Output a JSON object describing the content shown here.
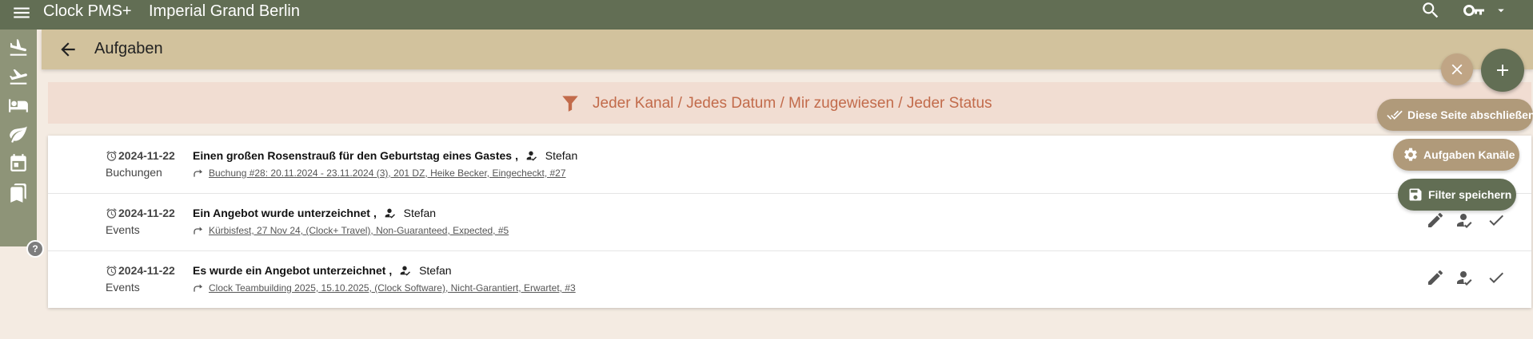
{
  "topbar": {
    "app_title": "Clock PMS+",
    "hotel_name": "Imperial Grand Berlin",
    "icons": [
      "menu-icon",
      "search-icon",
      "key-icon",
      "caret-down-icon"
    ]
  },
  "sidebar": {
    "items": [
      "arrivals-icon",
      "departures-icon",
      "bed-icon",
      "leaf-icon",
      "calendar-icon",
      "bookmark-icon"
    ],
    "help_label": "?"
  },
  "header": {
    "title": "Aufgaben"
  },
  "filter": {
    "text": "Jeder Kanal / Jedes Datum / Mir zugewiesen / Jeder Status"
  },
  "tasks": [
    {
      "date": "2024-11-22",
      "category": "Buchungen",
      "title": "Einen großen Rosenstrauß für den Geburtstag eines Gastes",
      "separator": ",",
      "assignee": "Stefan",
      "link": "Buchung #28: 20.11.2024 - 23.11.2024 (3), 201 DZ, Heike Becker, Eingecheckt, #27"
    },
    {
      "date": "2024-11-22",
      "category": "Events",
      "title": "Ein Angebot wurde unterzeichnet",
      "separator": ",",
      "assignee": "Stefan",
      "link": "Kürbisfest, 27 Nov 24, (Clock+ Travel), Non-Guaranteed, Expected, #5"
    },
    {
      "date": "2024-11-22",
      "category": "Events",
      "title": "Es wurde ein Angebot unterzeichnet",
      "separator": ",",
      "assignee": "Stefan",
      "link": "Clock Teambuilding 2025, 15.10.2025, (Clock Software), Nicht-Garantiert, Erwartet, #3"
    }
  ],
  "fab_menu": {
    "close_page_label": "Diese Seite abschließen",
    "channels_label": "Aufgaben Kanäle",
    "save_filter_label": "Filter speichern"
  },
  "colors": {
    "topbar": "#626e54",
    "header": "#d2c29d",
    "filter_bg": "#f1ddd2",
    "filter_text": "#c26b4b",
    "page_bg": "#f4ebe2"
  }
}
